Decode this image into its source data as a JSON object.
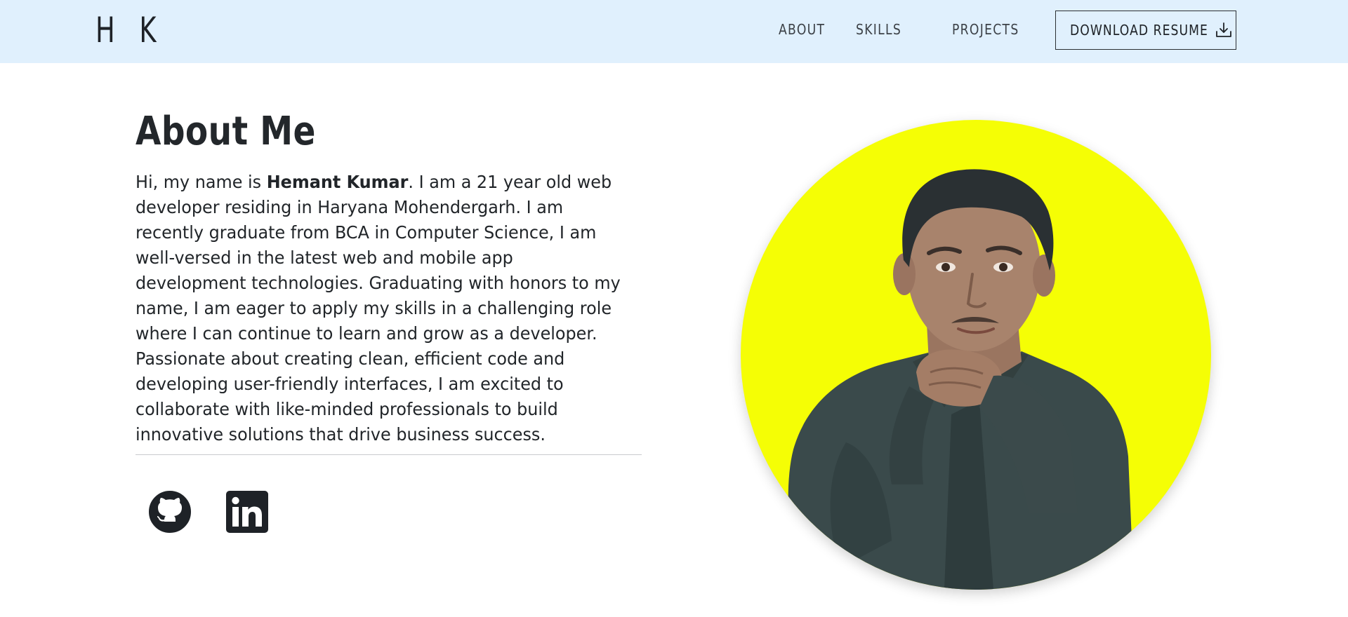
{
  "header": {
    "brand": "H K",
    "nav": {
      "about": "ABOUT",
      "skills": "SKILLS",
      "projects": "PROJECTS"
    },
    "resume_button": {
      "label": "DOWNLOAD RESUME",
      "icon": "download-icon"
    }
  },
  "about": {
    "heading": "About Me",
    "intro": "Hi, my name is ",
    "name": "Hemant Kumar",
    "body": ". I am a 21 year old web developer residing in Haryana Mohendergarh. I am recently graduate from BCA in Computer Science, I am well-versed in the latest web and mobile app development technologies. Graduating with honors to my name, I am eager to apply my skills in a challenging role where I can continue to learn and grow as a developer. Passionate about creating clean, efficient code and developing user-friendly interfaces, I am excited to collaborate with like-minded professionals to build innovative solutions that drive business success."
  },
  "social": [
    {
      "icon": "github-icon"
    },
    {
      "icon": "linkedin-icon"
    }
  ],
  "portrait": {
    "background": "#f5fe05"
  },
  "colors": {
    "navbar_bg": "#e0f0fd",
    "text": "#212529",
    "portrait_bg": "#f5fe05"
  }
}
